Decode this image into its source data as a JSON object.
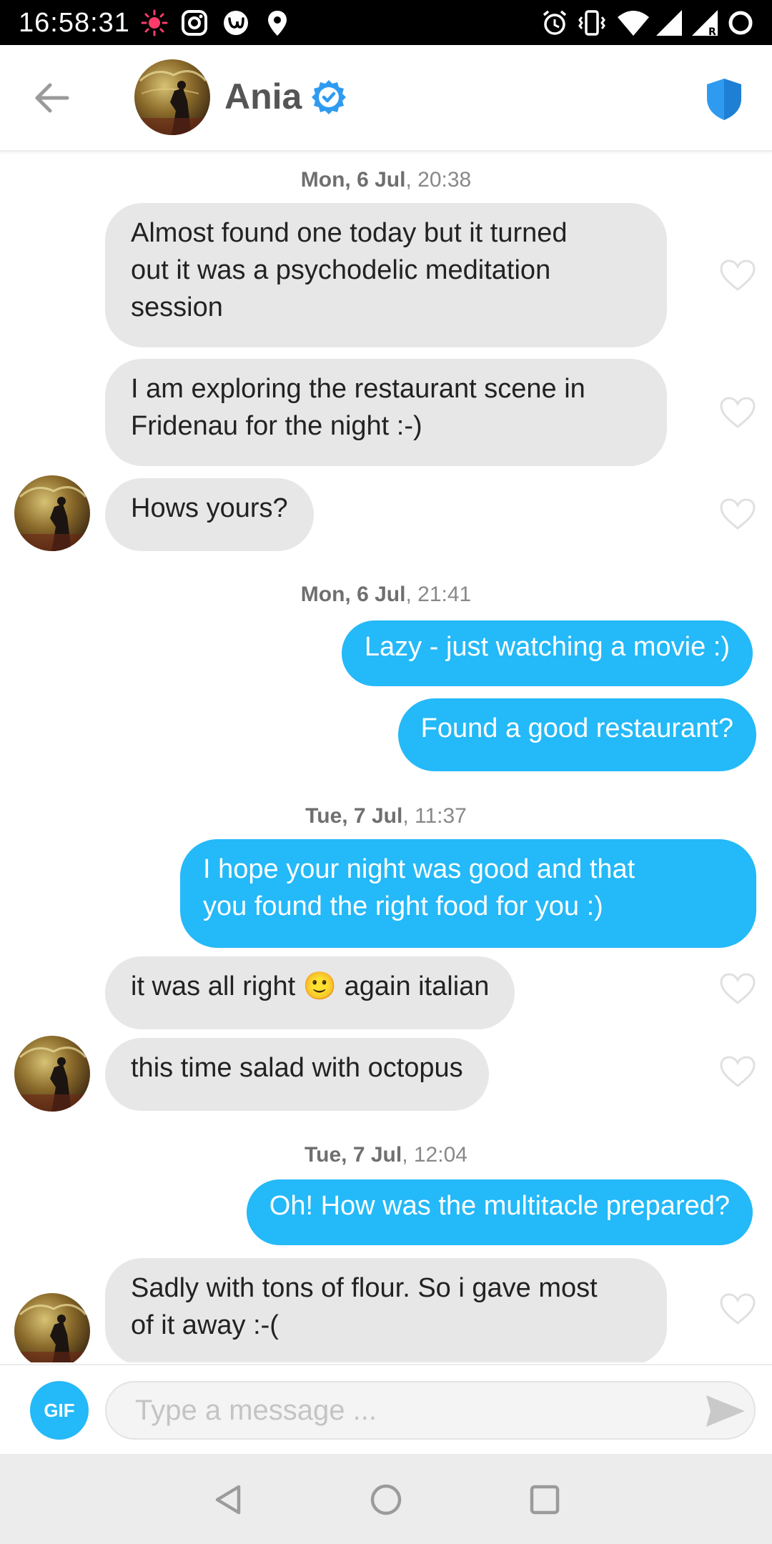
{
  "status_bar": {
    "time": "16:58:31",
    "left_icons": [
      "notification-dot-icon",
      "instagram-icon",
      "app-icon",
      "location-pin-icon"
    ],
    "right_icons": [
      "alarm-icon",
      "vibrate-icon",
      "wifi-icon",
      "signal-icon",
      "signal-roaming-icon",
      "battery-ring-icon"
    ]
  },
  "header": {
    "contact_name": "Ania",
    "verified": true,
    "accent_color": "#2f9bf0"
  },
  "messages": [
    {
      "type": "timestamp",
      "day": "Mon, 6 Jul",
      "time": ", 20:38"
    },
    {
      "type": "incoming",
      "text": [
        "Almost found one today but it turned",
        "out it was a psychodelic meditation",
        "session"
      ]
    },
    {
      "type": "incoming",
      "text": [
        "I am exploring the restaurant scene in",
        "Fridenau for the night :-)"
      ]
    },
    {
      "type": "incoming",
      "text": [
        "Hows yours?"
      ],
      "avatar": true
    },
    {
      "type": "timestamp",
      "day": "Mon, 6 Jul",
      "time": ", 21:41"
    },
    {
      "type": "outgoing",
      "text": [
        "Lazy - just watching a movie :)"
      ]
    },
    {
      "type": "outgoing",
      "text": [
        "Found a good restaurant?"
      ]
    },
    {
      "type": "timestamp",
      "day": "Tue, 7 Jul",
      "time": ", 11:37"
    },
    {
      "type": "outgoing",
      "text": [
        "I hope your night was good and that",
        "you found the right food for you :)"
      ]
    },
    {
      "type": "incoming",
      "text": [
        "it was all right 🙂 again italian"
      ]
    },
    {
      "type": "incoming",
      "text": [
        "this time salad with octopus"
      ],
      "avatar": true
    },
    {
      "type": "timestamp",
      "day": "Tue, 7 Jul",
      "time": ", 12:04"
    },
    {
      "type": "outgoing",
      "text": [
        "Oh! How was the multitacle prepared?"
      ]
    },
    {
      "type": "incoming",
      "text": [
        "Sadly with tons of flour. So i gave most",
        "of it away :-("
      ],
      "avatar": true
    }
  ],
  "composer": {
    "gif_label": "GIF",
    "placeholder": "Type a message ...",
    "value": ""
  },
  "colors": {
    "outgoing_bubble": "#24b9f8",
    "incoming_bubble": "#e7e7e7",
    "timestamp_text": "#888888"
  }
}
